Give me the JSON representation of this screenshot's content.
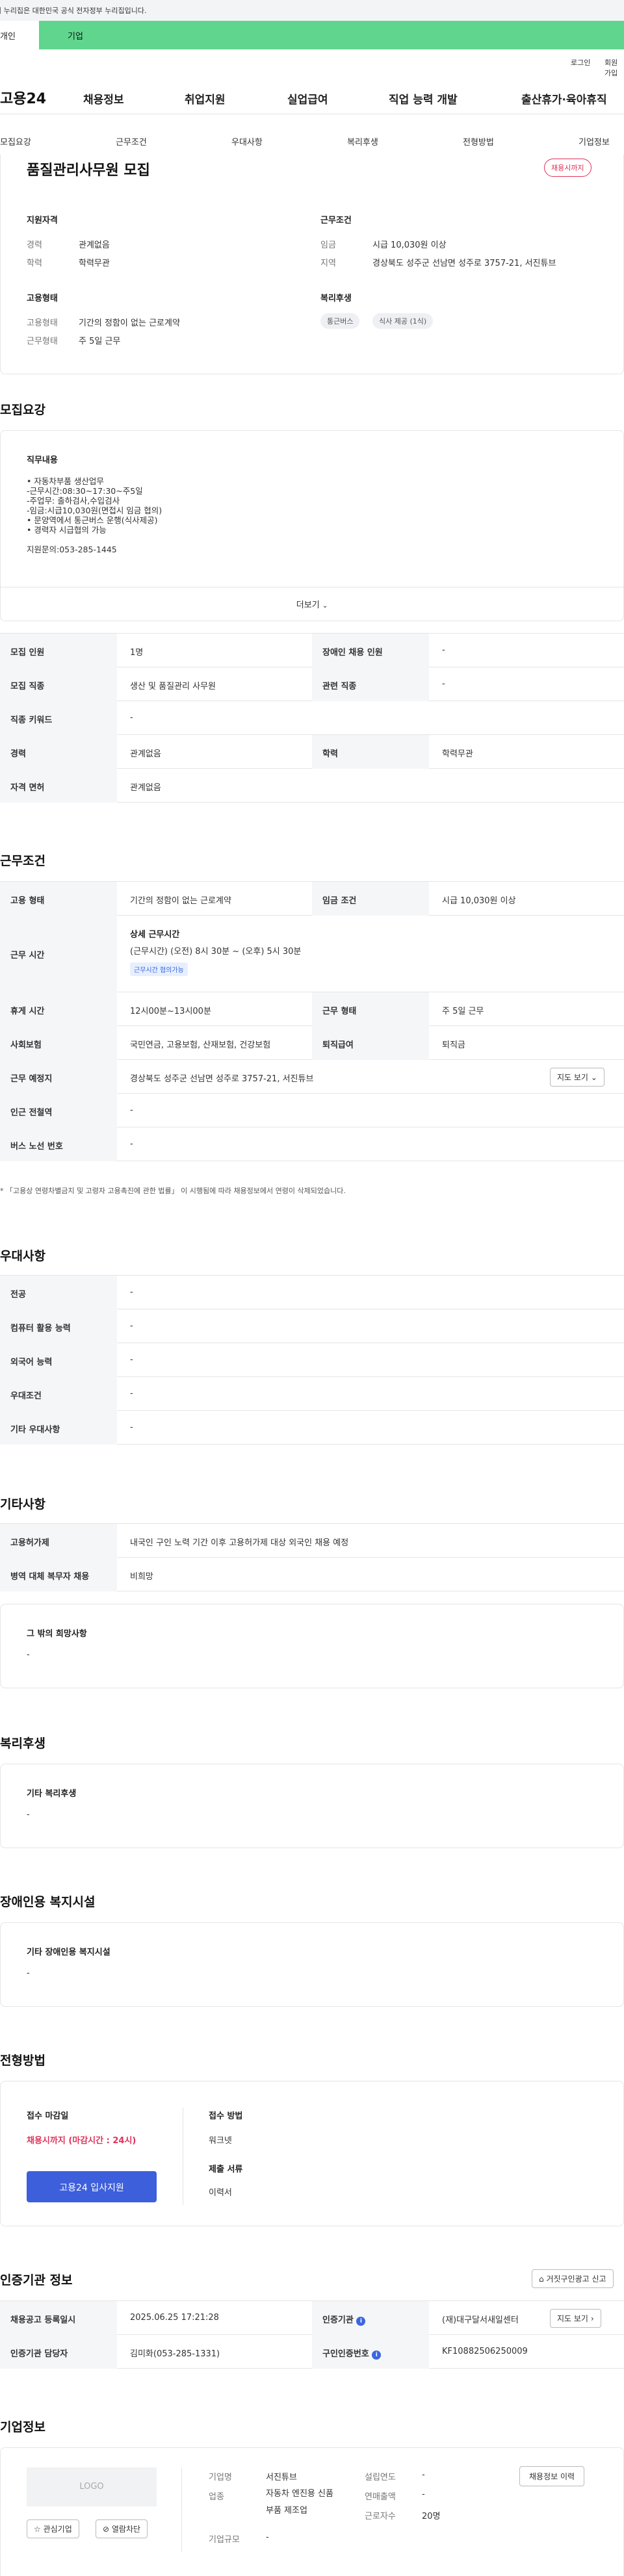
{
  "gov_banner": "이 누리집은 대한민국 공식 전자정부 누리집입니다.",
  "service_tabs": {
    "personal": "개인",
    "company": "기업"
  },
  "util": {
    "login": "로그인",
    "join": "회원가입"
  },
  "gnb": {
    "logo": "고용24",
    "items": [
      "채용정보",
      "취업지원",
      "실업급여",
      "직업 능력 개발",
      "출산휴가·육아휴직"
    ]
  },
  "tabs": [
    "모집요강",
    "근무조건",
    "우대사항",
    "복리후생",
    "전형방법",
    "기업정보"
  ],
  "summary": {
    "title": "품질관리사무원 모집",
    "badge": "채용시까지",
    "qual_title": "지원자격",
    "career_k": "경력",
    "career_v": "관계없음",
    "edu_k": "학력",
    "edu_v": "학력무관",
    "cond_title": "근무조건",
    "wage_k": "임금",
    "wage_v": "시급 10,030원 이상",
    "region_k": "지역",
    "region_v": "경상북도 성주군 선남면 성주로 3757-21, 서진튜브",
    "emp_title": "고용형태",
    "emptype_k": "고용형태",
    "emptype_v": "기간의 정함이 없는 근로계약",
    "workform_k": "근무형태",
    "workform_v": "주 5일 근무",
    "welfare_title": "복리후생",
    "welfare_tags": [
      "통근버스",
      "식사 제공 (1식)"
    ]
  },
  "recruit": {
    "section": "모집요강",
    "duty_title": "직무내용",
    "duty_lines": [
      "• 자동차부품 생산업무",
      "-근무시간:08:30~17:30~주5일",
      "-주업무: 출하검사,수입검사",
      "-임금:시급10,030원(면접시 임금 협의)",
      "• 문양역에서 통근버스 운행(식사제공)",
      "• 경력자 시급협의 가능"
    ],
    "contact": "지원문의:053-285-1445",
    "more": "더보기",
    "rows": [
      [
        "모집 인원",
        "1명",
        "장애인 채용 인원",
        "-"
      ],
      [
        "모집 직종",
        "생산 및 품질관리 사무원",
        "관련 직종",
        "-"
      ],
      [
        "직종 키워드",
        "-"
      ],
      [
        "경력",
        "관계없음",
        "학력",
        "학력무관"
      ],
      [
        "자격 면허",
        "관계없음"
      ]
    ]
  },
  "work": {
    "section": "근무조건",
    "emptype": [
      "고용 형태",
      "기간의 정함이 없는 근로계약",
      "임금 조건",
      "시급 10,030원 이상"
    ],
    "hours_k": "근무 시간",
    "hours_title": "상세 근무시간",
    "hours_v": "(근무시간) (오전) 8시 30분 ~ (오후) 5시 30분",
    "hours_tag": "근무시간 협의가능",
    "rest": [
      "휴게 시간",
      "12시00분~13시00분",
      "근무 형태",
      "주 5일 근무"
    ],
    "insurance": [
      "사회보험",
      "국민연금, 고용보험, 산재보험, 건강보험",
      "퇴직급여",
      "퇴직금"
    ],
    "location_k": "근무 예정지",
    "location_v": "경상북도 성주군 선남면 성주로 3757-21, 서진튜브",
    "map_btn": "지도 보기",
    "subway": [
      "인근 전철역",
      "-"
    ],
    "bus": [
      "버스 노선 번호",
      "-"
    ],
    "note": "* 「고용상 연령차별금지 및 고령자 고용촉진에 관한 법률」 이 시행됨에 따라 채용정보에서 연령이 삭제되었습니다."
  },
  "pref": {
    "section": "우대사항",
    "rows": [
      [
        "전공",
        "-"
      ],
      [
        "컴퓨터 활용 능력",
        "-"
      ],
      [
        "외국어 능력",
        "-"
      ],
      [
        "우대조건",
        "-"
      ],
      [
        "기타 우대사항",
        "-"
      ]
    ]
  },
  "etc": {
    "section": "기타사항",
    "rows": [
      [
        "고용허가제",
        "내국인 구인 노력 기간 이후 고용허가제 대상 외국인 채용 예정"
      ],
      [
        "병역 대체 복무자 채용",
        "비희망"
      ]
    ],
    "box_title": "그 밖의 희망사항",
    "box_value": "-"
  },
  "welfare": {
    "section": "복리후생",
    "box_title": "기타 복리후생",
    "box_value": "-"
  },
  "disabled": {
    "section": "장애인용 복지시설",
    "box_title": "기타 장애인용 복지시설",
    "box_value": "-"
  },
  "selection": {
    "section": "전형방법",
    "deadline_title": "접수 마감일",
    "deadline_value": "채용시까지 (마감시간 : 24시)",
    "apply_btn": "고용24 입사지원",
    "method_title": "접수 방법",
    "method_value": "워크넷",
    "docs_title": "제출 서류",
    "docs_value": "이력서"
  },
  "agency": {
    "section": "인증기관 정보",
    "report_btn": "거짓구인광고 신고",
    "rows": [
      [
        "채용공고 등록일시",
        "2025.06.25 17:21:28",
        "인증기관",
        "(재)대구달서새일센터"
      ],
      [
        "인증기관 담당자",
        "김미화(053-285-1331)",
        "구인인증번호",
        "KF10882506250009"
      ]
    ],
    "map_btn": "지도 보기"
  },
  "company": {
    "section": "기업정보",
    "logo": "LOGO",
    "fav_btn": "관심기업",
    "block_btn": "열람차단",
    "name_k": "기업명",
    "name_v": "서진튜브",
    "ind_k": "업종",
    "ind_v": "자동차 엔진용 신품 부품 제조업",
    "size_k": "기업규모",
    "size_v": "-",
    "est_k": "설립연도",
    "est_v": "-",
    "sales_k": "연매출액",
    "sales_v": "-",
    "emp_k": "근로자수",
    "emp_v": "20명",
    "history_btn": "채용정보 이력"
  }
}
